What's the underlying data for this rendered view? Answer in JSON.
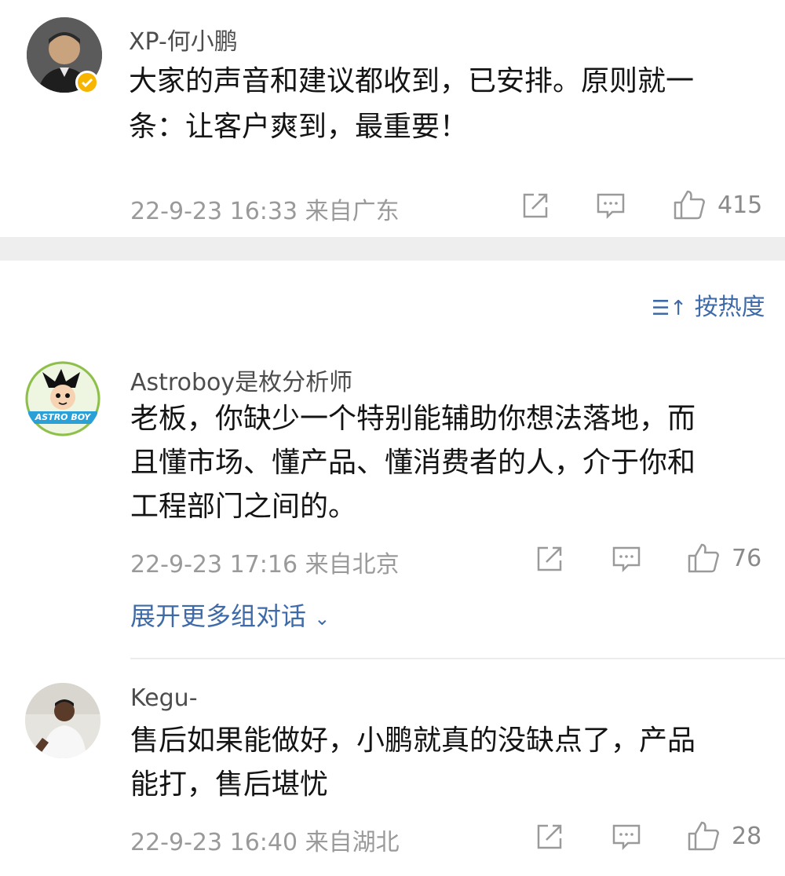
{
  "post": {
    "author": "XP-何小鹏",
    "text_line1": "大家的声音和建议都收到，已安排。原则就一",
    "text_line2": "条：让客户爽到，最重要！",
    "meta": "22-9-23 16:33 来自广东",
    "likes": "415"
  },
  "sort": {
    "label": "按热度"
  },
  "comments": [
    {
      "author": "Astroboy是枚分析师",
      "avatar_text": "ASTRO BOY",
      "line1": "老板，你缺少一个特别能辅助你想法落地，而",
      "line2": "且懂市场、懂产品、懂消费者的人，介于你和",
      "line3": "工程部门之间的。",
      "meta": "22-9-23 17:16 来自北京",
      "likes": "76",
      "expand_label": "展开更多组对话"
    },
    {
      "author": "Kegu-",
      "line1": "售后如果能做好，小鹏就真的没缺点了，产品",
      "line2": "能打，售后堪忧",
      "meta": "22-9-23 16:40 来自湖北",
      "likes": "28"
    }
  ],
  "colors": {
    "link": "#3f6aa8",
    "verified": "#f7b500",
    "divider": "#eeeeee"
  }
}
